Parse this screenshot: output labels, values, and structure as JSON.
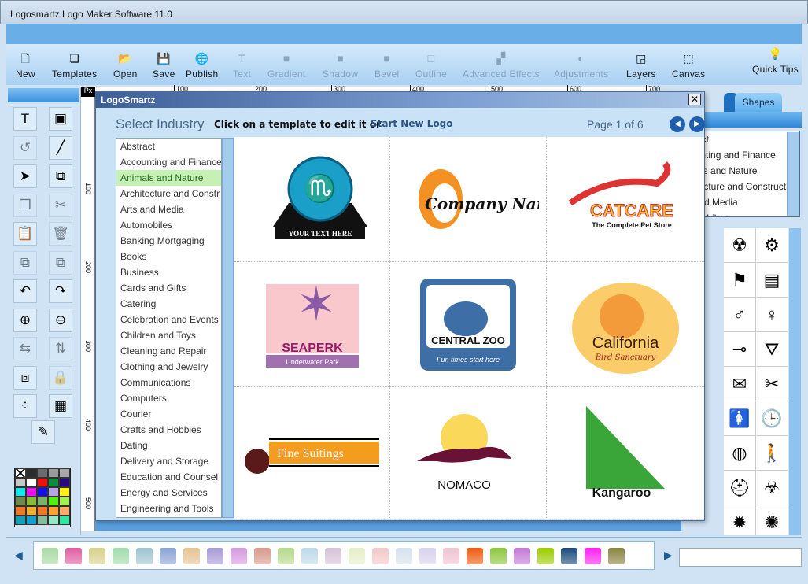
{
  "window": {
    "title": "Logosmartz Logo Maker Software 11.0"
  },
  "toolbar": {
    "items": [
      {
        "label": "New",
        "icon": "new-document-icon",
        "enabled": true
      },
      {
        "label": "Templates",
        "icon": "templates-icon",
        "enabled": true
      },
      {
        "label": "Open",
        "icon": "open-folder-icon",
        "enabled": true
      },
      {
        "label": "Save",
        "icon": "floppy-disk-icon",
        "enabled": true
      },
      {
        "label": "Publish",
        "icon": "publish-globe-icon",
        "enabled": true
      },
      {
        "label": "Text",
        "icon": "text-icon",
        "enabled": false
      },
      {
        "label": "Gradient",
        "icon": "gradient-icon",
        "enabled": false
      },
      {
        "label": "Shadow",
        "icon": "shadow-icon",
        "enabled": false
      },
      {
        "label": "Bevel",
        "icon": "bevel-icon",
        "enabled": false
      },
      {
        "label": "Outline",
        "icon": "outline-icon",
        "enabled": false
      },
      {
        "label": "Advanced Effects",
        "icon": "advanced-effects-icon",
        "enabled": false
      },
      {
        "label": "Adjustments",
        "icon": "adjustments-icon",
        "enabled": false
      },
      {
        "label": "Layers",
        "icon": "layers-icon",
        "enabled": true
      },
      {
        "label": "Canvas",
        "icon": "canvas-icon",
        "enabled": true
      },
      {
        "label": "Quick Tips",
        "icon": "lightbulb-icon",
        "enabled": true
      }
    ]
  },
  "left_tools": [
    {
      "name": "text-tool",
      "glyph": "T",
      "enabled": true
    },
    {
      "name": "insert-image-tool",
      "glyph": "▣",
      "enabled": true
    },
    {
      "name": "rotate-tool",
      "glyph": "↺",
      "enabled": false
    },
    {
      "name": "line-tool",
      "glyph": "╱",
      "enabled": true
    },
    {
      "name": "select-tool",
      "glyph": "➤",
      "enabled": true
    },
    {
      "name": "import-tool",
      "glyph": "⧉",
      "enabled": true
    },
    {
      "name": "copy-tool",
      "glyph": "❐",
      "enabled": false
    },
    {
      "name": "cut-tool",
      "glyph": "✂",
      "enabled": false
    },
    {
      "name": "paste-tool",
      "glyph": "📋",
      "enabled": true
    },
    {
      "name": "delete-tool",
      "glyph": "🗑",
      "enabled": false
    },
    {
      "name": "bring-forward-tool",
      "glyph": "⧉",
      "enabled": false
    },
    {
      "name": "send-backward-tool",
      "glyph": "⧉",
      "enabled": false
    },
    {
      "name": "undo-tool",
      "glyph": "↶",
      "enabled": true
    },
    {
      "name": "redo-tool",
      "glyph": "↷",
      "enabled": true
    },
    {
      "name": "zoom-in-tool",
      "glyph": "⊕",
      "enabled": true
    },
    {
      "name": "zoom-out-tool",
      "glyph": "⊖",
      "enabled": true
    },
    {
      "name": "flip-horizontal-tool",
      "glyph": "⇆",
      "enabled": false
    },
    {
      "name": "flip-vertical-tool",
      "glyph": "⇅",
      "enabled": false
    },
    {
      "name": "group-tool",
      "glyph": "⧈",
      "enabled": true
    },
    {
      "name": "lock-tool",
      "glyph": "🔒",
      "enabled": false
    },
    {
      "name": "align-tool",
      "glyph": "⁘",
      "enabled": true
    },
    {
      "name": "arrange-tool",
      "glyph": "▦",
      "enabled": true
    },
    {
      "name": "color-picker-tool",
      "glyph": "✎",
      "enabled": true
    }
  ],
  "palette": [
    "none",
    "#2b2b2b",
    "#6b6b6b",
    "#9a9a9a",
    "#a8a8a8",
    "#c8c8c8",
    "#ffffff",
    "#ee1111",
    "#0a8c3c",
    "#2a0a7a",
    "#11e8ee",
    "#ee11ee",
    "#1111ee",
    "#b5a4e6",
    "#ffee11",
    "#6e8a4a",
    "#8ab83a",
    "#7eb06a",
    "#55ee11",
    "#a6ee55",
    "#ee7722",
    "#eeaa33",
    "#ee7722",
    "#ffa033",
    "#ffaa66",
    "#11a0b8",
    "#11a0cc",
    "#88bb99",
    "#99e6c4",
    "#33e6a0"
  ],
  "ruler": {
    "unit": "Px",
    "h_labels": [
      "100",
      "200",
      "300",
      "400",
      "500",
      "600",
      "700"
    ],
    "v_labels": [
      "100",
      "200",
      "300",
      "400",
      "500"
    ]
  },
  "dialog": {
    "title": "LogoSmartz",
    "heading": "Select Industry",
    "instruction": "Click on a template to edit it or",
    "link": "Start New Logo",
    "page_info": "Page 1 of 6",
    "industries": [
      "Abstract",
      "Accounting and Finance",
      "Animals and Nature",
      "Architecture and Constr",
      "Arts and Media",
      "Automobiles",
      "Banking Mortgaging",
      "Books",
      "Business",
      "Cards and Gifts",
      "Catering",
      "Celebration and Events",
      "Children and Toys",
      "Cleaning and Repair",
      "Clothing and Jewelry",
      "Communications",
      "Computers",
      "Courier",
      "Crafts and Hobbies",
      "Dating",
      "Delivery and Storage",
      "Education and Counsel",
      "Energy and Services",
      "Engineering and Tools"
    ],
    "selected_industry": "Animals and Nature",
    "templates": [
      {
        "name": "scorpion",
        "text": "YOUR TEXT HERE"
      },
      {
        "name": "penguin",
        "text": "Company Name"
      },
      {
        "name": "catcare",
        "text": "CATCARE",
        "sub": "The Complete Pet Store"
      },
      {
        "name": "seaperk",
        "text": "SEAPERK",
        "sub": "Underwater Park"
      },
      {
        "name": "central-zoo",
        "text": "CENTRAL ZOO",
        "sub": "Fun times start here"
      },
      {
        "name": "california",
        "text": "California",
        "sub": "Bird Sanctuary"
      },
      {
        "name": "fine-suitings",
        "text": "Fine Suitings"
      },
      {
        "name": "nomaco",
        "text": "NOMACO"
      },
      {
        "name": "kangaroo",
        "text": "Kangaroo"
      }
    ]
  },
  "right_panel": {
    "tab_label": "Shapes",
    "category_list": [
      "Abstract",
      "Accounting and Finance",
      "Animals and Nature",
      "Architecture and Construction",
      "Arts and Media",
      "Automobiles"
    ],
    "shapes": [
      "☢",
      "⚙",
      "⚑",
      "▤",
      "♂",
      "♀",
      "⊸",
      "⛛",
      "✉",
      "✂",
      "🚺",
      "🕒",
      "◍",
      "🚶",
      "⛑",
      "☣",
      "✹",
      "✺"
    ]
  },
  "bottom_swatches": [
    "#a9d9a4",
    "#e05ea0",
    "#d8d08a",
    "#9fdcab",
    "#9cc5cf",
    "#8aa3d6",
    "#e6c391",
    "#a79ad6",
    "#d49adf",
    "#d99a8a",
    "#b6d98a",
    "#bcd9e6",
    "#d6c2d6",
    "#e6eec6",
    "#f3c8c8",
    "#d6e2ec",
    "#d8d2ec",
    "#f0c2d2",
    "#f05a10",
    "#8cc63e",
    "#c47ad6",
    "#9ccc00",
    "#1b4a7a",
    "#ff22ee",
    "#8a8440"
  ]
}
